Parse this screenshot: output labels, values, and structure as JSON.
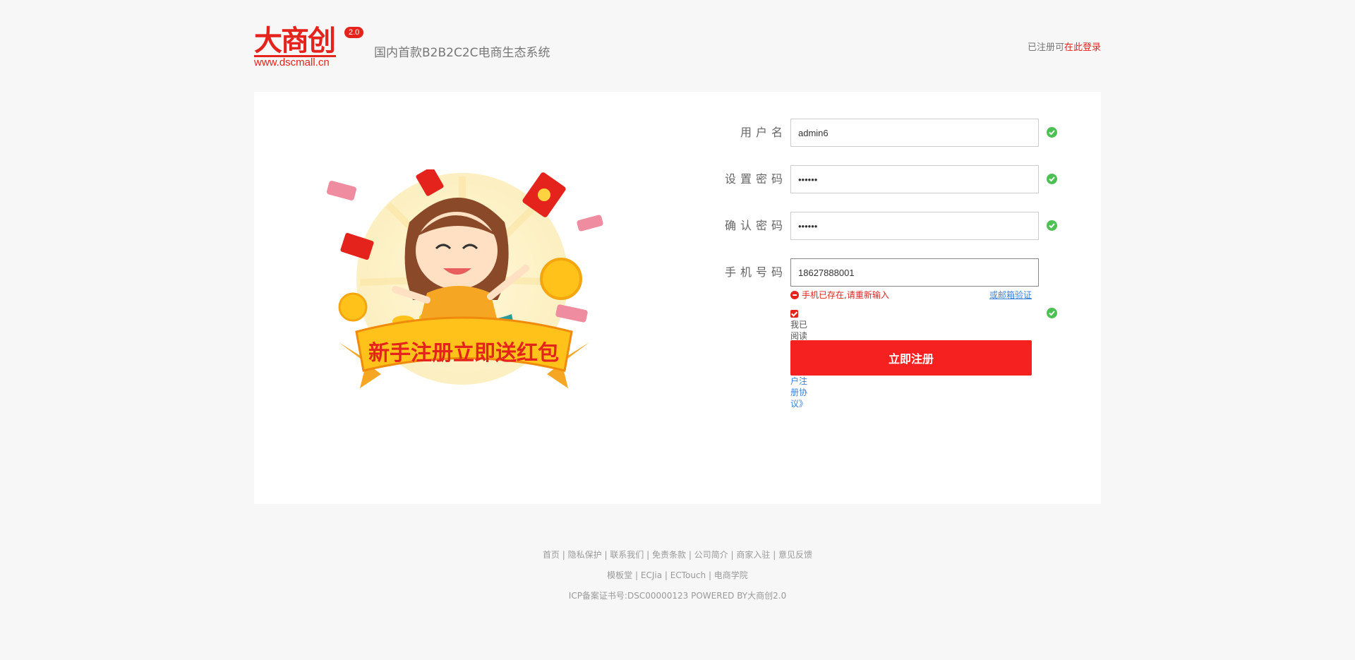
{
  "header": {
    "logo_text": "大商创",
    "logo_version": "2.0",
    "logo_url": "www.dscmall.cn",
    "slogan": "国内首款B2B2C2C电商生态系统",
    "login_prefix": "已注册可",
    "login_link": "在此登录"
  },
  "banner": {
    "text": "新手注册立即送红包"
  },
  "form": {
    "username": {
      "label": "用户名",
      "value": "admin6"
    },
    "password": {
      "label": "设置密码",
      "value": "••••••"
    },
    "confirm": {
      "label": "确认密码",
      "value": "••••••"
    },
    "phone": {
      "label": "手机号码",
      "value": "18627888001"
    },
    "phone_error": "手机已存在,请重新输入",
    "email_verify": "或邮箱验证",
    "agree_prefix": "我已阅读并同意",
    "agree_link": "《用户注册协议》",
    "submit": "立即注册"
  },
  "footer": {
    "links1": [
      "首页",
      "隐私保护",
      "联系我们",
      "免责条款",
      "公司简介",
      "商家入驻",
      "意见反馈"
    ],
    "links2": [
      "模板堂",
      "ECJia",
      "ECTouch",
      "电商学院"
    ],
    "icp": "ICP备案证书号:DSC00000123 POWERED BY大商创2.0"
  },
  "colors": {
    "accent": "#e4231c",
    "button": "#f52121",
    "success": "#4cc052",
    "link": "#3b82d6"
  }
}
